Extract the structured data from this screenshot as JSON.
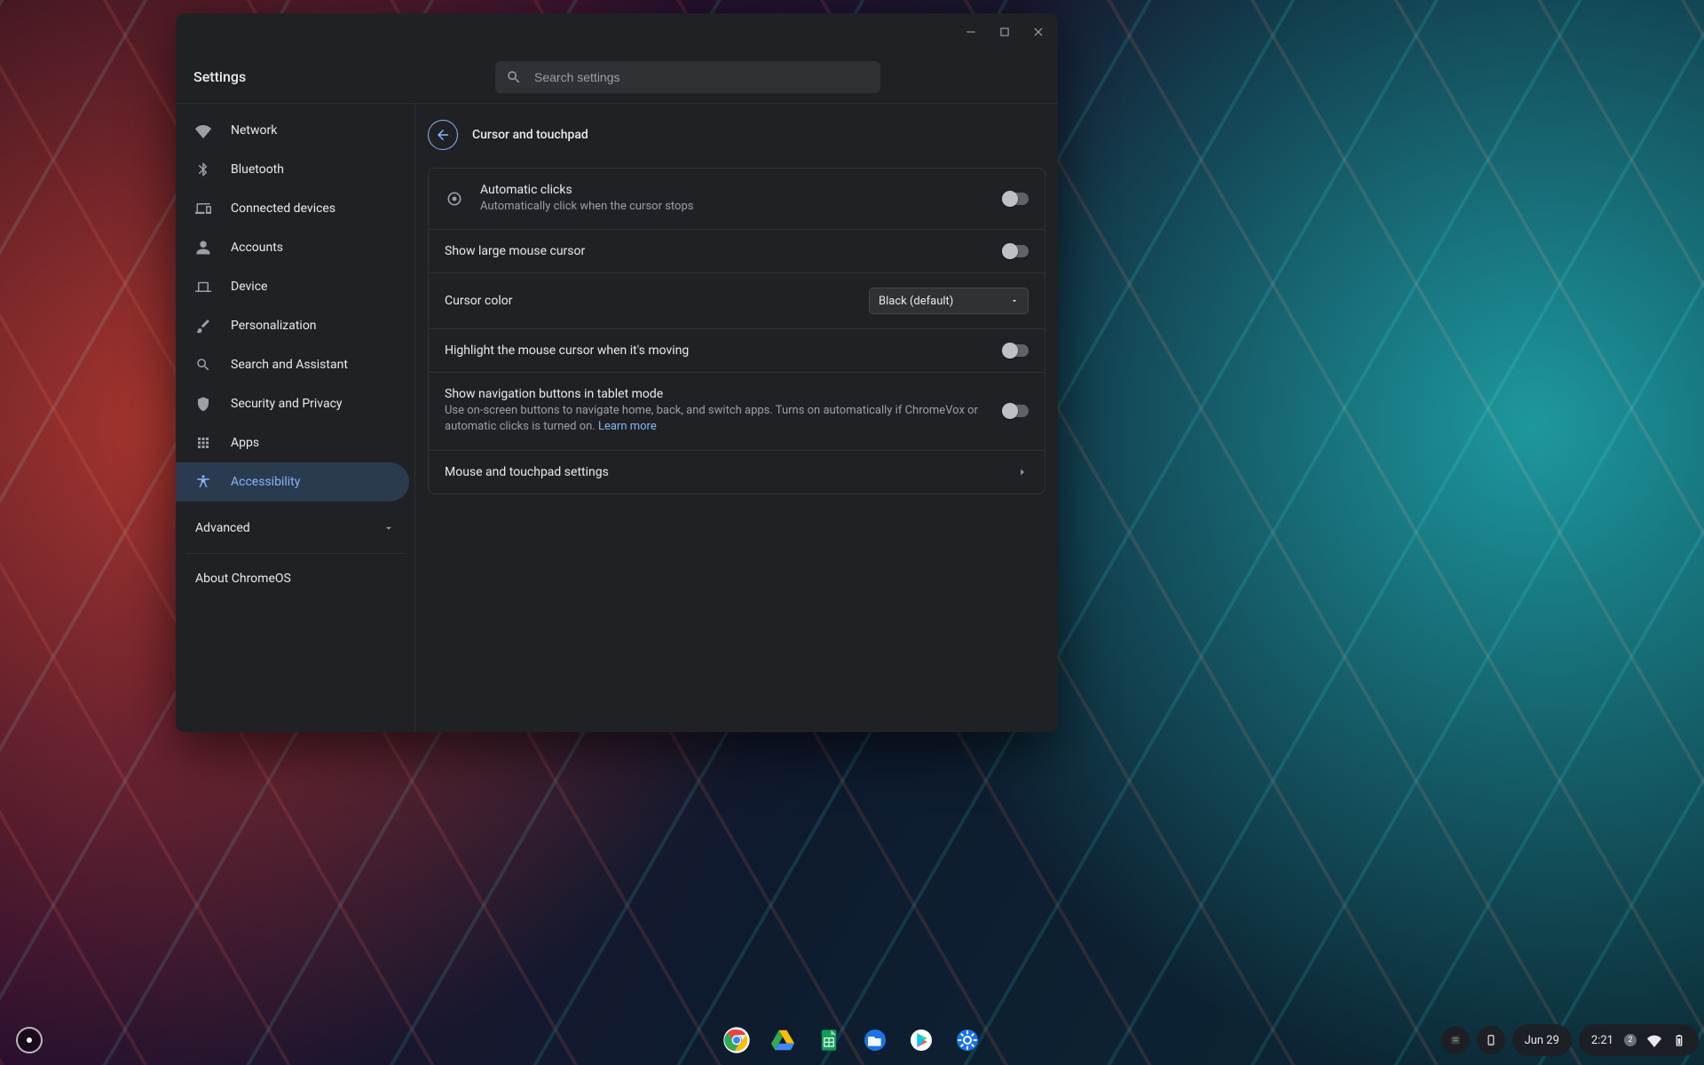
{
  "app_title": "Settings",
  "search": {
    "placeholder": "Search settings"
  },
  "window_controls": {
    "minimize": "Minimize",
    "maximize": "Maximize",
    "close": "Close"
  },
  "colors": {
    "accent": "#8ab4f8",
    "surface": "#202124",
    "input_bg": "#303134"
  },
  "sidebar": {
    "items": [
      {
        "label": "Network"
      },
      {
        "label": "Bluetooth"
      },
      {
        "label": "Connected devices"
      },
      {
        "label": "Accounts"
      },
      {
        "label": "Device"
      },
      {
        "label": "Personalization"
      },
      {
        "label": "Search and Assistant"
      },
      {
        "label": "Security and Privacy"
      },
      {
        "label": "Apps"
      },
      {
        "label": "Accessibility"
      }
    ],
    "active_index": 9,
    "advanced_label": "Advanced",
    "about_label": "About ChromeOS"
  },
  "page": {
    "title": "Cursor and touchpad",
    "rows": {
      "auto_clicks": {
        "title": "Automatic clicks",
        "sub": "Automatically click when the cursor stops",
        "value": false
      },
      "large_cursor": {
        "title": "Show large mouse cursor",
        "value": false
      },
      "cursor_color": {
        "title": "Cursor color",
        "selected": "Black (default)"
      },
      "highlight": {
        "title": "Highlight the mouse cursor when it's moving",
        "value": false
      },
      "nav_buttons": {
        "title": "Show navigation buttons in tablet mode",
        "sub_prefix": "Use on-screen buttons to navigate home, back, and switch apps. Turns on automatically if ChromeVox or automatic clicks is turned on. ",
        "learn_more": "Learn more",
        "value": false
      },
      "mouse_settings": {
        "title": "Mouse and touchpad settings"
      }
    }
  },
  "shelf": {
    "date": "Jun 29",
    "time": "2:21",
    "notification_count": "2",
    "apps": [
      "chrome",
      "drive",
      "sheets",
      "files",
      "play",
      "settings"
    ]
  }
}
